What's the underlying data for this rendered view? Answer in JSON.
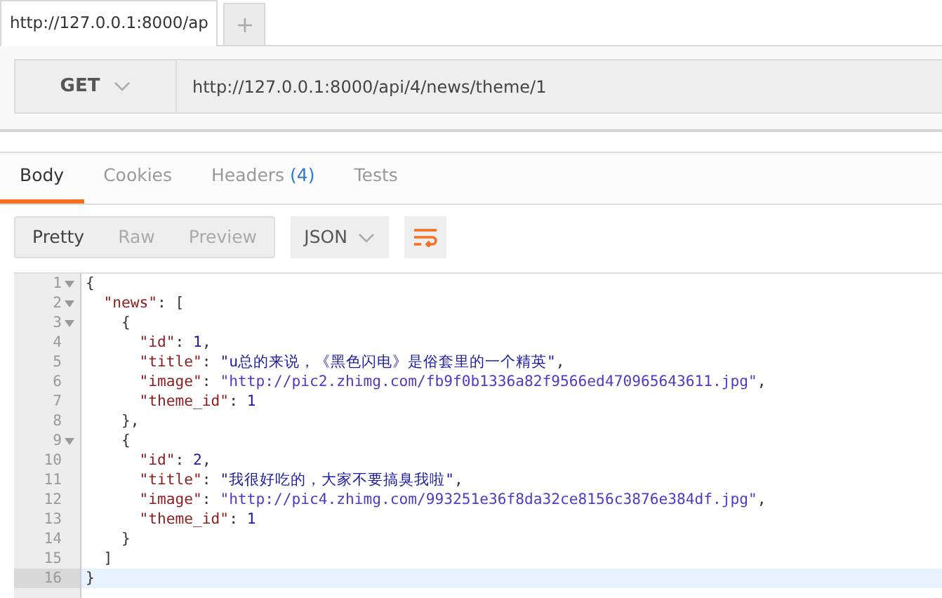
{
  "request_tabs": [
    {
      "label": "http://127.0.0.1:8000/ap",
      "selected": true
    }
  ],
  "new_tab": {
    "label": "+"
  },
  "request": {
    "method": "GET",
    "url": "http://127.0.0.1:8000/api/4/news/theme/1"
  },
  "response_tabs": [
    {
      "label": "Body",
      "selected": true
    },
    {
      "label": "Cookies",
      "selected": false
    },
    {
      "label": "Headers",
      "count": "(4)",
      "selected": false
    },
    {
      "label": "Tests",
      "selected": false
    }
  ],
  "view_modes": [
    {
      "label": "Pretty",
      "selected": true
    },
    {
      "label": "Raw",
      "selected": false
    },
    {
      "label": "Preview",
      "selected": false
    }
  ],
  "format": {
    "label": "JSON"
  },
  "editor": {
    "lines": [
      {
        "number": "1",
        "foldable": true,
        "current": false,
        "tokens": [
          {
            "kind": "punct",
            "text": "{"
          }
        ]
      },
      {
        "number": "2",
        "foldable": true,
        "current": false,
        "tokens": [
          {
            "kind": "key",
            "text": "  \"news\""
          },
          {
            "kind": "punct",
            "text": ": ["
          }
        ]
      },
      {
        "number": "3",
        "foldable": true,
        "current": false,
        "tokens": [
          {
            "kind": "punct",
            "text": "    {"
          }
        ]
      },
      {
        "number": "4",
        "foldable": false,
        "current": false,
        "tokens": [
          {
            "kind": "key",
            "text": "      \"id\""
          },
          {
            "kind": "punct",
            "text": ": "
          },
          {
            "kind": "number",
            "text": "1"
          },
          {
            "kind": "punct",
            "text": ","
          }
        ]
      },
      {
        "number": "5",
        "foldable": false,
        "current": false,
        "tokens": [
          {
            "kind": "key",
            "text": "      \"title\""
          },
          {
            "kind": "punct",
            "text": ": "
          },
          {
            "kind": "string",
            "text": "\"u总的来说，《黑色闪电》是俗套里的一个精英\""
          },
          {
            "kind": "punct",
            "text": ","
          }
        ]
      },
      {
        "number": "6",
        "foldable": false,
        "current": false,
        "tokens": [
          {
            "kind": "key",
            "text": "      \"image\""
          },
          {
            "kind": "punct",
            "text": ": "
          },
          {
            "kind": "url",
            "text": "\"http://pic2.zhimg.com/fb9f0b1336a82f9566ed470965643611.jpg\""
          },
          {
            "kind": "punct",
            "text": ","
          }
        ]
      },
      {
        "number": "7",
        "foldable": false,
        "current": false,
        "tokens": [
          {
            "kind": "key",
            "text": "      \"theme_id\""
          },
          {
            "kind": "punct",
            "text": ": "
          },
          {
            "kind": "number",
            "text": "1"
          }
        ]
      },
      {
        "number": "8",
        "foldable": false,
        "current": false,
        "tokens": [
          {
            "kind": "punct",
            "text": "    },"
          }
        ]
      },
      {
        "number": "9",
        "foldable": true,
        "current": false,
        "tokens": [
          {
            "kind": "punct",
            "text": "    {"
          }
        ]
      },
      {
        "number": "10",
        "foldable": false,
        "current": false,
        "tokens": [
          {
            "kind": "key",
            "text": "      \"id\""
          },
          {
            "kind": "punct",
            "text": ": "
          },
          {
            "kind": "number",
            "text": "2"
          },
          {
            "kind": "punct",
            "text": ","
          }
        ]
      },
      {
        "number": "11",
        "foldable": false,
        "current": false,
        "tokens": [
          {
            "kind": "key",
            "text": "      \"title\""
          },
          {
            "kind": "punct",
            "text": ": "
          },
          {
            "kind": "string",
            "text": "\"我很好吃的，大家不要搞臭我啦\""
          },
          {
            "kind": "punct",
            "text": ","
          }
        ]
      },
      {
        "number": "12",
        "foldable": false,
        "current": false,
        "tokens": [
          {
            "kind": "key",
            "text": "      \"image\""
          },
          {
            "kind": "punct",
            "text": ": "
          },
          {
            "kind": "url",
            "text": "\"http://pic4.zhimg.com/993251e36f8da32ce8156c3876e384df.jpg\""
          },
          {
            "kind": "punct",
            "text": ","
          }
        ]
      },
      {
        "number": "13",
        "foldable": false,
        "current": false,
        "tokens": [
          {
            "kind": "key",
            "text": "      \"theme_id\""
          },
          {
            "kind": "punct",
            "text": ": "
          },
          {
            "kind": "number",
            "text": "1"
          }
        ]
      },
      {
        "number": "14",
        "foldable": false,
        "current": false,
        "tokens": [
          {
            "kind": "punct",
            "text": "    }"
          }
        ]
      },
      {
        "number": "15",
        "foldable": false,
        "current": false,
        "tokens": [
          {
            "kind": "punct",
            "text": "  ]"
          }
        ]
      },
      {
        "number": "16",
        "foldable": false,
        "current": true,
        "tokens": [
          {
            "kind": "punct",
            "text": "}"
          }
        ]
      }
    ]
  }
}
